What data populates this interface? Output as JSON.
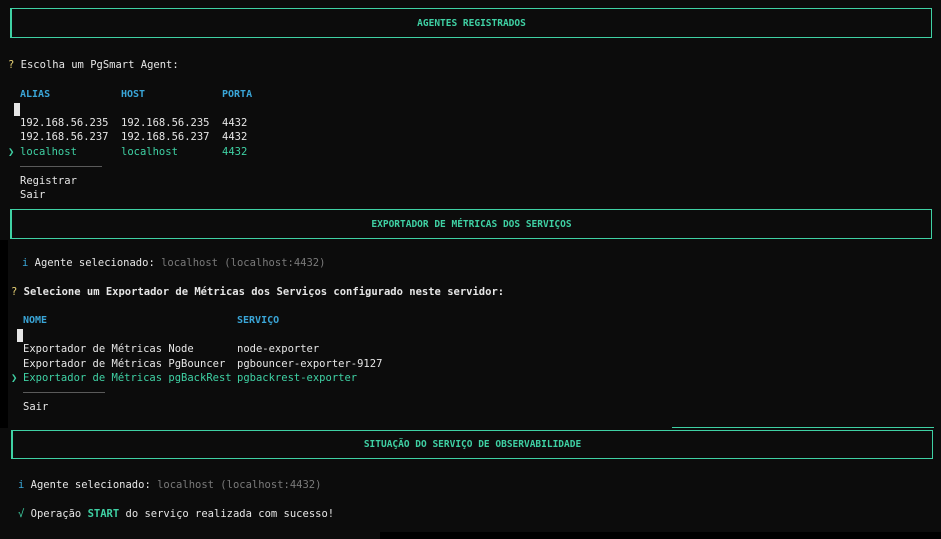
{
  "section1": {
    "banner": "AGENTES REGISTRADOS",
    "question_mark": "?",
    "question": "Escolha um PgSmart Agent:",
    "headers": [
      "ALIAS",
      "HOST",
      "PORTA"
    ],
    "rows": [
      {
        "alias": "192.168.56.235",
        "host": "192.168.56.235",
        "port": "4432"
      },
      {
        "alias": "192.168.56.237",
        "host": "192.168.56.237",
        "port": "4432"
      },
      {
        "alias": "localhost",
        "host": "localhost",
        "port": "4432"
      }
    ],
    "selected_row": 2,
    "pointer": "❯",
    "separator": "──────────────",
    "extra_options": [
      "Registrar",
      "Sair"
    ]
  },
  "section2": {
    "banner": "EXPORTADOR DE MÉTRICAS DOS SERVIÇOS",
    "info_icon": "i",
    "agent_label": "Agente selecionado:",
    "agent_value": "localhost (localhost:4432)",
    "question_mark": "?",
    "question": "Selecione um Exportador de Métricas dos Serviços configurado neste servidor:",
    "headers": [
      "NOME",
      "SERVIÇO"
    ],
    "rows": [
      {
        "name": "Exportador de Métricas Node",
        "service": "node-exporter"
      },
      {
        "name": "Exportador de Métricas PgBouncer",
        "service": "pgbouncer-exporter-9127"
      },
      {
        "name": "Exportador de Métricas pgBackRest",
        "service": "pgbackrest-exporter"
      }
    ],
    "selected_row": 2,
    "pointer": "❯",
    "separator": "──────────────",
    "extra_options": [
      "Sair"
    ]
  },
  "section3": {
    "banner": "SITUAÇÃO DO SERVIÇO DE OBSERVABILIDADE",
    "info_icon": "i",
    "agent_label": "Agente selecionado:",
    "agent_value": "localhost (localhost:4432)",
    "success_icon": "√",
    "success_prefix": "Operação",
    "success_keyword": "START",
    "success_suffix": "do serviço realizada com sucesso!"
  },
  "colors": {
    "background": "#0c0c0c",
    "accent": "#3fd1a4",
    "header": "#3aa6d8",
    "question": "#e6d074",
    "text": "#e6e6e6",
    "dim": "#7a7a7a"
  }
}
